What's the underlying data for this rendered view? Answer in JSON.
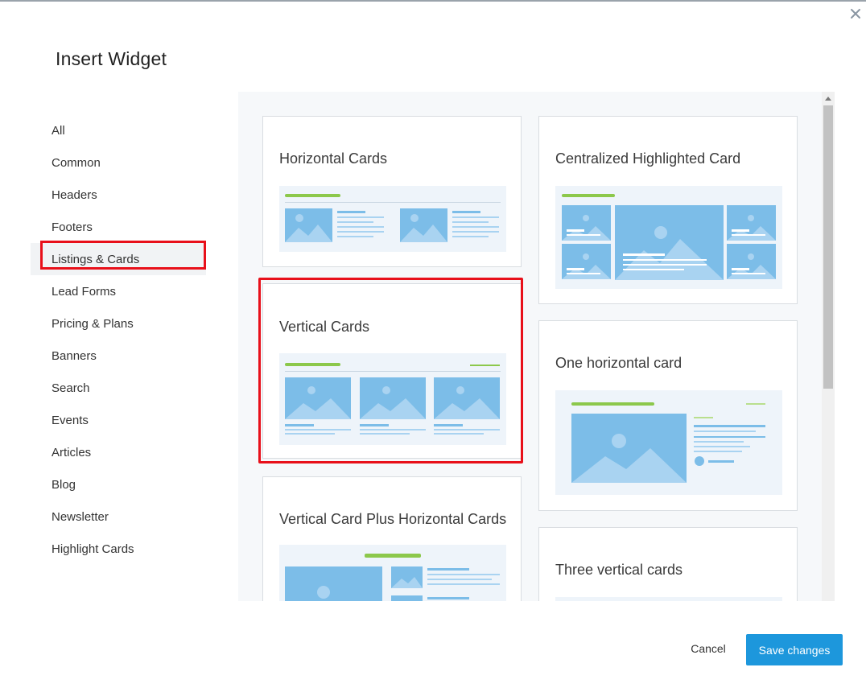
{
  "modal": {
    "title": "Insert Widget",
    "close_icon": "close-icon"
  },
  "sidebar": {
    "items": [
      {
        "label": "All"
      },
      {
        "label": "Common"
      },
      {
        "label": "Headers"
      },
      {
        "label": "Footers"
      },
      {
        "label": "Listings & Cards",
        "active": true
      },
      {
        "label": "Lead Forms"
      },
      {
        "label": "Pricing & Plans"
      },
      {
        "label": "Banners"
      },
      {
        "label": "Search"
      },
      {
        "label": "Events"
      },
      {
        "label": "Articles"
      },
      {
        "label": "Blog"
      },
      {
        "label": "Newsletter"
      },
      {
        "label": "Highlight Cards"
      }
    ]
  },
  "widgets": [
    {
      "title": "Horizontal Cards"
    },
    {
      "title": "Centralized Highlighted Card"
    },
    {
      "title": "Vertical Cards",
      "highlighted": true
    },
    {
      "title": "One horizontal card"
    },
    {
      "title": "Vertical Card Plus Horizontal Cards"
    },
    {
      "title": "Three vertical cards"
    }
  ],
  "footer": {
    "cancel_label": "Cancel",
    "save_label": "Save changes"
  },
  "colors": {
    "accent": "#1d97dc",
    "highlight": "#e8101a",
    "preview_bg": "#eef4fa",
    "image_blue": "#7cbde8",
    "bar_green": "#8cc84b"
  }
}
